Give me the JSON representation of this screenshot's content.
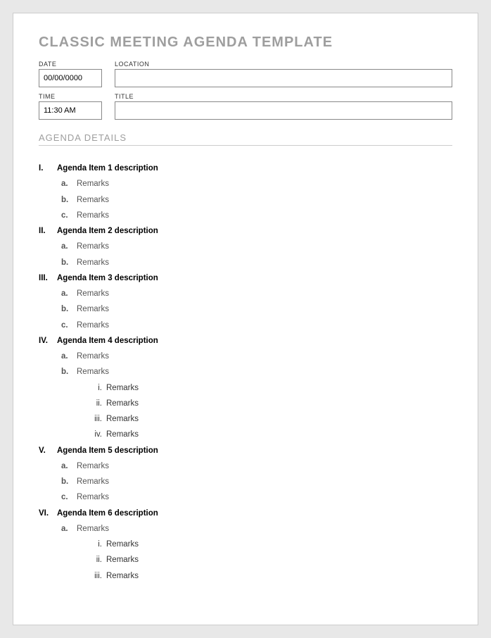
{
  "title": "CLASSIC MEETING AGENDA TEMPLATE",
  "fields": {
    "date": {
      "label": "DATE",
      "value": "00/00/0000"
    },
    "location": {
      "label": "LOCATION",
      "value": ""
    },
    "time": {
      "label": "TIME",
      "value": "11:30 AM"
    },
    "titleField": {
      "label": "TITLE",
      "value": ""
    }
  },
  "section_header": "AGENDA DETAILS",
  "agenda": [
    {
      "marker": "I.",
      "title": "Agenda Item 1 description",
      "remarks": [
        {
          "marker": "a.",
          "text": "Remarks"
        },
        {
          "marker": "b.",
          "text": "Remarks"
        },
        {
          "marker": "c.",
          "text": "Remarks"
        }
      ]
    },
    {
      "marker": "II.",
      "title": "Agenda Item 2 description",
      "remarks": [
        {
          "marker": "a.",
          "text": "Remarks"
        },
        {
          "marker": "b.",
          "text": "Remarks"
        }
      ]
    },
    {
      "marker": "III.",
      "title": "Agenda Item 3 description",
      "remarks": [
        {
          "marker": "a.",
          "text": "Remarks"
        },
        {
          "marker": "b.",
          "text": "Remarks"
        },
        {
          "marker": "c.",
          "text": "Remarks"
        }
      ]
    },
    {
      "marker": "IV.",
      "title": "Agenda Item 4 description",
      "remarks": [
        {
          "marker": "a.",
          "text": "Remarks"
        },
        {
          "marker": "b.",
          "text": "Remarks",
          "sub": [
            {
              "marker": "i.",
              "text": "Remarks"
            },
            {
              "marker": "ii.",
              "text": "Remarks"
            },
            {
              "marker": "iii.",
              "text": "Remarks"
            },
            {
              "marker": "iv.",
              "text": "Remarks"
            }
          ]
        }
      ]
    },
    {
      "marker": "V.",
      "title": "Agenda Item 5 description",
      "remarks": [
        {
          "marker": "a.",
          "text": "Remarks"
        },
        {
          "marker": "b.",
          "text": "Remarks"
        },
        {
          "marker": "c.",
          "text": "Remarks"
        }
      ]
    },
    {
      "marker": "VI.",
      "title": "Agenda Item 6 description",
      "remarks": [
        {
          "marker": "a.",
          "text": "Remarks",
          "sub": [
            {
              "marker": "i.",
              "text": "Remarks"
            },
            {
              "marker": "ii.",
              "text": "Remarks"
            },
            {
              "marker": "iii.",
              "text": "Remarks"
            }
          ]
        }
      ]
    }
  ]
}
